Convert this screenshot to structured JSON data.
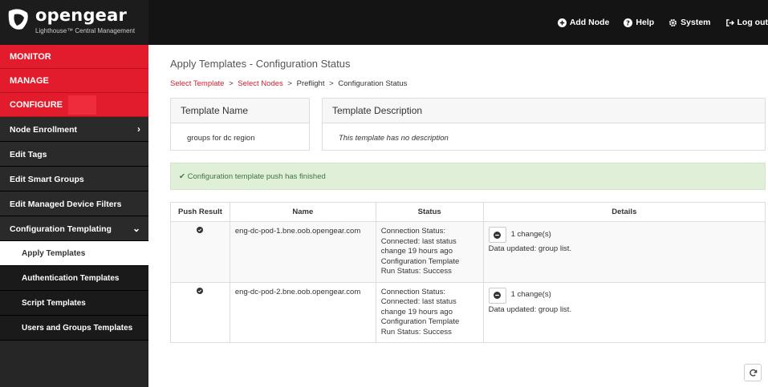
{
  "brand": {
    "name": "opengear",
    "subtitle": "Lighthouse™ Central Management"
  },
  "topnav": [
    {
      "label": "Add Node",
      "icon": "plus-circle-icon"
    },
    {
      "label": "Help",
      "icon": "question-circle-icon"
    },
    {
      "label": "System",
      "icon": "gear-icon"
    },
    {
      "label": "Log out",
      "icon": "sign-out-icon"
    }
  ],
  "sidebar": {
    "sections": [
      "MONITOR",
      "MANAGE",
      "CONFIGURE"
    ],
    "items": [
      "Node Enrollment",
      "Edit Tags",
      "Edit Smart Groups",
      "Edit Managed Device Filters",
      "Configuration Templating"
    ],
    "subitems": [
      "Apply Templates",
      "Authentication Templates",
      "Script Templates",
      "Users and Groups Templates"
    ]
  },
  "page": {
    "title": "Apply Templates - Configuration Status",
    "breadcrumb": [
      "Select Template",
      "Select Nodes",
      "Preflight",
      "Configuration Status"
    ]
  },
  "template": {
    "name_header": "Template Name",
    "name_value": "groups for dc region",
    "desc_header": "Template Description",
    "desc_value": "This template has no description"
  },
  "alert": {
    "text": "Configuration template push has finished"
  },
  "table": {
    "headers": [
      "Push Result",
      "Name",
      "Status",
      "Details"
    ],
    "rows": [
      {
        "name": "eng-dc-pod-1.bne.oob.opengear.com",
        "status": [
          "Connection Status:",
          "Connected: last status",
          "change 19 hours ago",
          "Configuration Template",
          "Run Status: Success"
        ],
        "changes": "1 change(s)",
        "details": "Data updated: group list."
      },
      {
        "name": "eng-dc-pod-2.bne.oob.opengear.com",
        "status": [
          "Connection Status:",
          "Connected: last status",
          "change 19 hours ago",
          "Configuration Template",
          "Run Status: Success"
        ],
        "changes": "1 change(s)",
        "details": "Data updated: group list."
      }
    ]
  },
  "colors": {
    "accent": "#e21c2c",
    "sidebar": "#262626",
    "success_bg": "#e0efd8"
  }
}
